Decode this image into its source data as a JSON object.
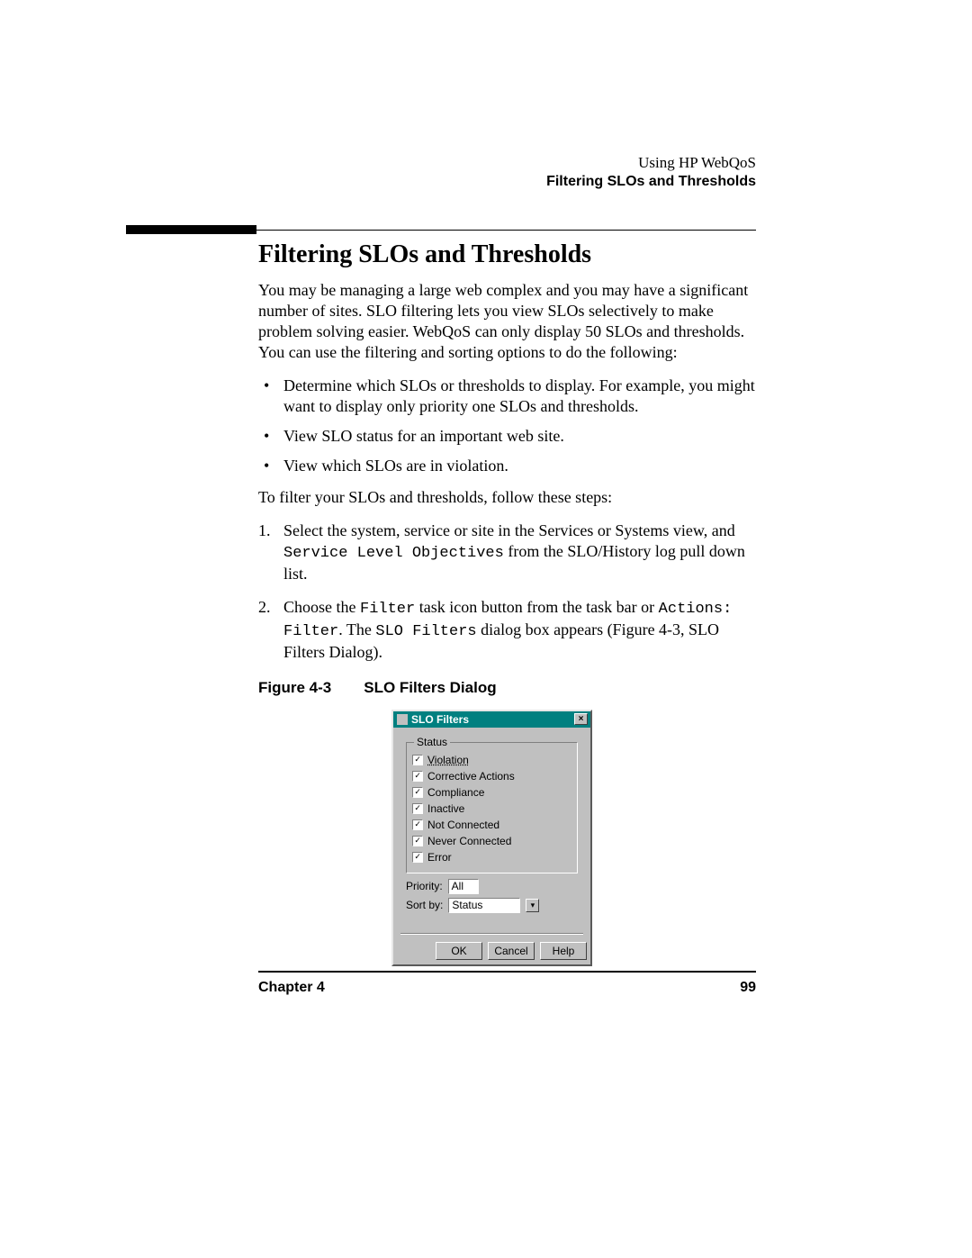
{
  "header": {
    "line1": "Using HP WebQoS",
    "line2": "Filtering SLOs and Thresholds"
  },
  "title": "Filtering SLOs and Thresholds",
  "intro": "You may be managing a large web complex and you may have a significant number of sites. SLO filtering lets you view SLOs selectively to make problem solving easier. WebQoS can only display 50 SLOs and thresholds. You can use the filtering and sorting options to do the following:",
  "bullets": [
    "Determine which SLOs or thresholds to display. For example, you might want to display only priority one SLOs and thresholds.",
    "View SLO status for an important web site.",
    "View which SLOs are in violation."
  ],
  "lead_steps": "To filter your SLOs and thresholds, follow these steps:",
  "steps": {
    "s1a": " Select the system, service or site in the Services or Systems view, and ",
    "s1_mono": "Service Level Objectives",
    "s1b": " from the SLO/History log pull down list.",
    "s2a": "Choose the ",
    "s2_mono1": "Filter",
    "s2b": " task icon button from the task bar or ",
    "s2_mono2": "Actions: Filter",
    "s2c": ". The ",
    "s2_mono3": "SLO Filters",
    "s2d": " dialog box appears (Figure 4-3, SLO Filters Dialog)."
  },
  "figure": {
    "label": "Figure 4-3",
    "caption": "SLO Filters Dialog"
  },
  "dialog": {
    "title": "SLO Filters",
    "close_glyph": "×",
    "group_label": "Status",
    "checks": [
      "Violation",
      "Corrective Actions",
      "Compliance",
      "Inactive",
      "Not Connected",
      "Never Connected",
      "Error"
    ],
    "priority_label": "Priority:",
    "priority_value": "All",
    "sortby_label": "Sort by:",
    "sortby_value": "Status",
    "dd_glyph": "▾",
    "buttons": {
      "ok": "OK",
      "cancel": "Cancel",
      "help": "Help"
    }
  },
  "footer": {
    "left": "Chapter 4",
    "right": "99"
  }
}
